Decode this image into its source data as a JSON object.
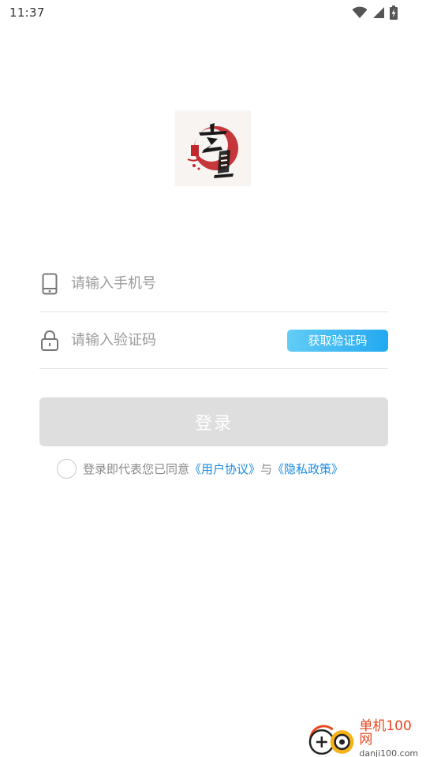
{
  "status_bar": {
    "time": "11:37",
    "icons": [
      "wifi-icon",
      "signal-icon",
      "battery-icon"
    ]
  },
  "logo": {
    "name": "xuanzhen-logo",
    "text": "玄真",
    "accent_color": "#c0262b"
  },
  "form": {
    "phone": {
      "icon": "phone-icon",
      "placeholder": "请输入手机号",
      "value": ""
    },
    "code": {
      "icon": "lock-icon",
      "placeholder": "请输入验证码",
      "value": "",
      "button_label": "获取验证码"
    }
  },
  "login": {
    "label": "登录"
  },
  "agreement": {
    "checked": false,
    "prefix": "登录即代表您已同意",
    "user_agreement": "《用户协议》",
    "connector": "与",
    "privacy_policy": "《隐私政策》",
    "link_color": "#1c8ce0"
  },
  "watermark": {
    "title": "单机100网",
    "subtitle": "danji100.com"
  },
  "colors": {
    "primary_button_gradient": [
      "#63ccf6",
      "#22a9f0"
    ],
    "login_disabled": "#dedede",
    "divider": "#e3e3e3",
    "placeholder": "#9b9b9b"
  }
}
